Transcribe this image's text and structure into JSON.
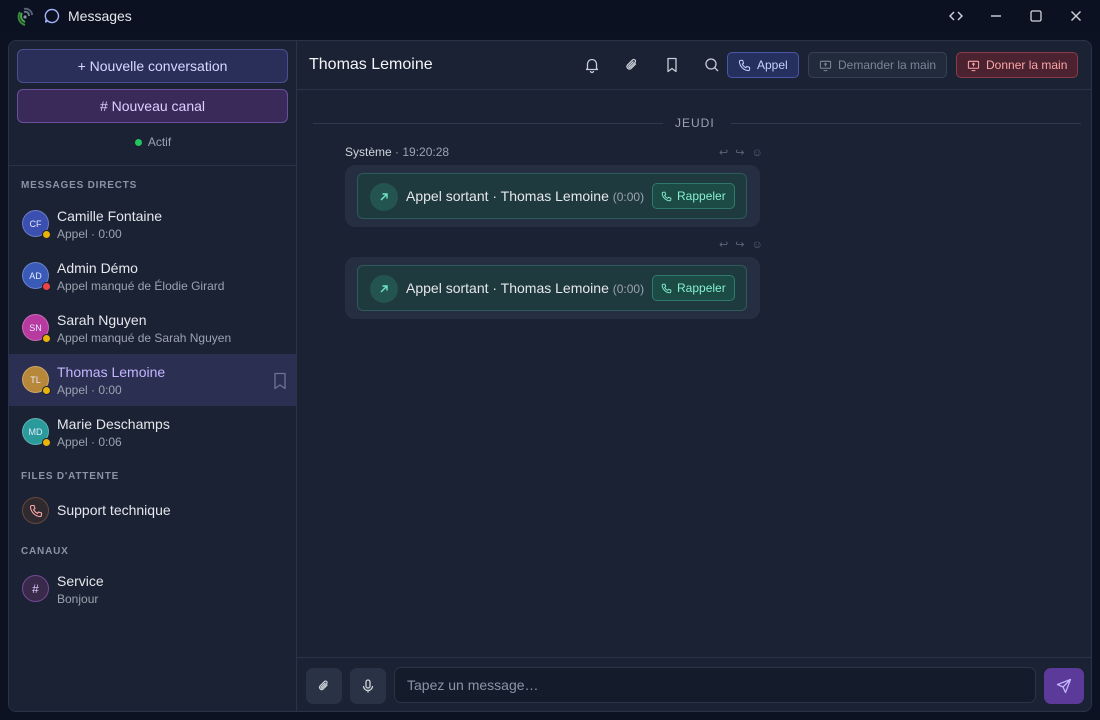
{
  "window": {
    "title": "Messages"
  },
  "sidebar": {
    "new_conversation_label": "+ Nouvelle conversation",
    "new_channel_label": "# Nouveau canal",
    "status_label": "Actif",
    "sections": {
      "direct": "MESSAGES DIRECTS",
      "queues": "FILES D'ATTENTE",
      "channels": "CANAUX"
    },
    "direct_messages": [
      {
        "initials": "CF",
        "name": "Camille Fontaine",
        "preview": "Appel · 0:00",
        "presence": "away",
        "avatar_color": "#3b4fb0"
      },
      {
        "initials": "AD",
        "name": "Admin Démo",
        "preview": "Appel manqué de Élodie Girard",
        "presence": "busy",
        "avatar_color": "#3a5ab8"
      },
      {
        "initials": "SN",
        "name": "Sarah Nguyen",
        "preview": "Appel manqué de Sarah Nguyen",
        "presence": "away",
        "avatar_color": "#b83aa0"
      },
      {
        "initials": "TL",
        "name": "Thomas Lemoine",
        "preview": "Appel · 0:00",
        "presence": "away",
        "avatar_color": "#b8883a",
        "active": true
      },
      {
        "initials": "MD",
        "name": "Marie Deschamps",
        "preview": "Appel · 0:06",
        "presence": "away",
        "avatar_color": "#2a9a9a"
      }
    ],
    "queues": [
      {
        "name": "Support technique",
        "icon": "phone-icon"
      }
    ],
    "channels": [
      {
        "symbol": "#",
        "name": "Service",
        "preview": "Bonjour"
      }
    ]
  },
  "conversation": {
    "title": "Thomas Lemoine",
    "buttons": {
      "call": "Appel",
      "request_control": "Demander la main",
      "give_control": "Donner la main"
    },
    "day_separator": "JEUDI",
    "messages": [
      {
        "sender": "Système",
        "separator": "·",
        "time": "19:20:28",
        "call_text": "Appel sortant · Thomas Lemoine",
        "duration": "(0:00)",
        "action": "Rappeler"
      },
      {
        "call_text": "Appel sortant · Thomas Lemoine",
        "duration": "(0:00)",
        "action": "Rappeler"
      }
    ],
    "message_actions": "↩ ↪ ☺"
  },
  "composer": {
    "placeholder": "Tapez un message…",
    "value": ""
  },
  "colors": {
    "presence_away": "#eab308",
    "presence_busy": "#ef4444",
    "status_active": "#22c55e",
    "accent": "#8b5cf6"
  }
}
